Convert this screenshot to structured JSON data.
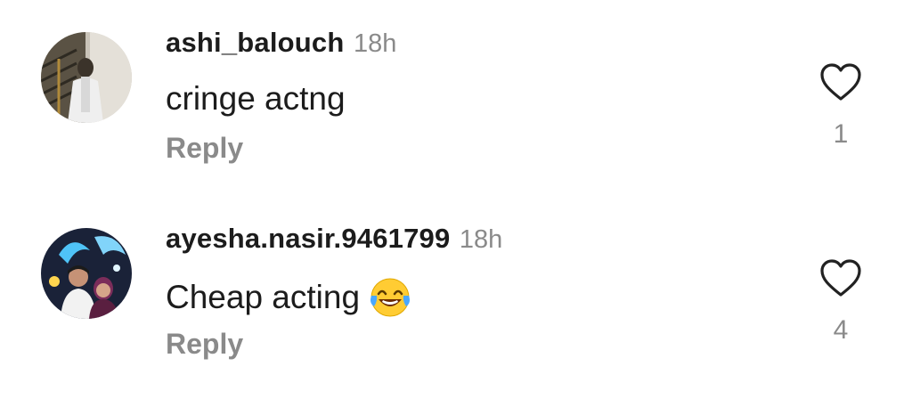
{
  "comments": [
    {
      "username": "ashi_balouch",
      "time": "18h",
      "text": "cringe actng",
      "emoji": "",
      "reply_label": "Reply",
      "like_count": "1",
      "like_icon": "heart-outline-icon",
      "avatar": "profile-photo-woman-on-stairs"
    },
    {
      "username": "ayesha.nasir.9461799",
      "time": "18h",
      "text": "Cheap acting",
      "emoji": "face-with-tears-of-joy",
      "reply_label": "Reply",
      "like_count": "4",
      "like_icon": "heart-outline-icon",
      "avatar": "profile-photo-couple-with-lights"
    }
  ],
  "colors": {
    "text_primary": "#1c1c1c",
    "text_secondary": "#8a8a8a",
    "background": "#ffffff"
  }
}
